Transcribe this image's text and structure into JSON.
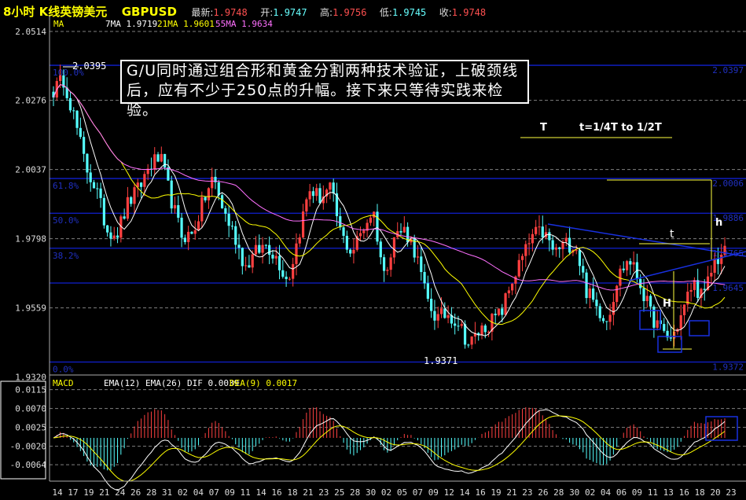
{
  "header": {
    "title": "8小时 K线英镑美元",
    "symbol": "GBPUSD",
    "last_label": "最新:",
    "last": "1.9748",
    "open_label": "开:",
    "open": "1.9747",
    "high_label": "高:",
    "high": "1.9756",
    "low_label": "低:",
    "low": "1.9745",
    "close_label": "收:",
    "close": "1.9748"
  },
  "ma_legend": {
    "label": "MA",
    "ma7": "7MA 1.9719",
    "ma21": "21MA 1.9601",
    "ma55": "55MA 1.9634"
  },
  "macd_legend": {
    "label": "MACD",
    "ema": "EMA(12) EMA(26) DIF 0.0039",
    "dea": "DEA(9) 0.0017"
  },
  "annotations": {
    "note": "G/U同时通过组合形和黄金分割两种技术验证，上破颈线后，应有不少于250点的升幅。接下来只等待实践来检验。",
    "T": "T",
    "t_rule": "t=1/4T to 1/2T",
    "t": "t",
    "h": "h",
    "H": "H",
    "high_mark": "2.0395",
    "low_mark": "1.9371"
  },
  "colors": {
    "up": "#ff4040",
    "down": "#55ffff",
    "ma7": "#ffffff",
    "ma21": "#ffff00",
    "ma55": "#ff70ff",
    "fib": "#1020d0",
    "grid": "#808080"
  },
  "chart_data": [
    {
      "type": "candlestick",
      "title": "8小时 K线英镑美元 GBPUSD",
      "y_ticks": [
        "2.0514",
        "2.0276",
        "2.0037",
        "1.9798",
        "1.9559",
        "1.9320"
      ],
      "ylim": [
        1.932,
        2.0514
      ],
      "x_ticks": [
        "14",
        "17",
        "19",
        "21",
        "24",
        "26",
        "28",
        "31",
        "02",
        "04",
        "07",
        "09",
        "11",
        "14",
        "16",
        "18",
        "21",
        "23",
        "25",
        "28",
        "30",
        "02",
        "05",
        "07",
        "09",
        "12",
        "14",
        "16",
        "19",
        "21",
        "23",
        "26",
        "28",
        "30",
        "02",
        "04",
        "06",
        "09",
        "11",
        "13",
        "16",
        "18",
        "20",
        "23"
      ],
      "approx_close_path": [
        2.031,
        2.035,
        2.021,
        2.005,
        1.997,
        1.983,
        1.982,
        1.992,
        1.997,
        2.005,
        2.008,
        1.994,
        1.981,
        1.981,
        1.992,
        2.001,
        1.989,
        1.981,
        1.97,
        1.975,
        1.978,
        1.973,
        1.965,
        1.981,
        1.997,
        1.994,
        1.997,
        1.981,
        1.975,
        1.983,
        1.99,
        1.967,
        1.981,
        1.983,
        1.975,
        1.959,
        1.952,
        1.954,
        1.951,
        1.943,
        1.948,
        1.951,
        1.954,
        1.965,
        1.973,
        1.981,
        1.982,
        1.975,
        1.978,
        1.978,
        1.962,
        1.956,
        1.952,
        1.967,
        1.973,
        1.965,
        1.954,
        1.948,
        1.945,
        1.954,
        1.965,
        1.959,
        1.972,
        1.975
      ],
      "moving_averages": [
        7,
        21,
        55
      ],
      "fibonacci": [
        {
          "level": "100.0%",
          "price": "2.0397"
        },
        {
          "level": "61.8%",
          "price": "2.0006"
        },
        {
          "level": "50.0%",
          "price": "1.9886"
        },
        {
          "level": "38.2%",
          "price": "1.9765"
        },
        {
          "level": "",
          "price": "1.9645"
        },
        {
          "level": "0.0%",
          "price": "1.9372"
        }
      ],
      "grid": true
    },
    {
      "type": "macd",
      "y_ticks": [
        "0.0115",
        "0.0070",
        "0.0025",
        "-0.0020",
        "-0.0064"
      ],
      "ylim": [
        -0.0075,
        0.0125
      ],
      "series": [
        {
          "name": "DIF"
        },
        {
          "name": "DEA(9)"
        }
      ]
    }
  ]
}
